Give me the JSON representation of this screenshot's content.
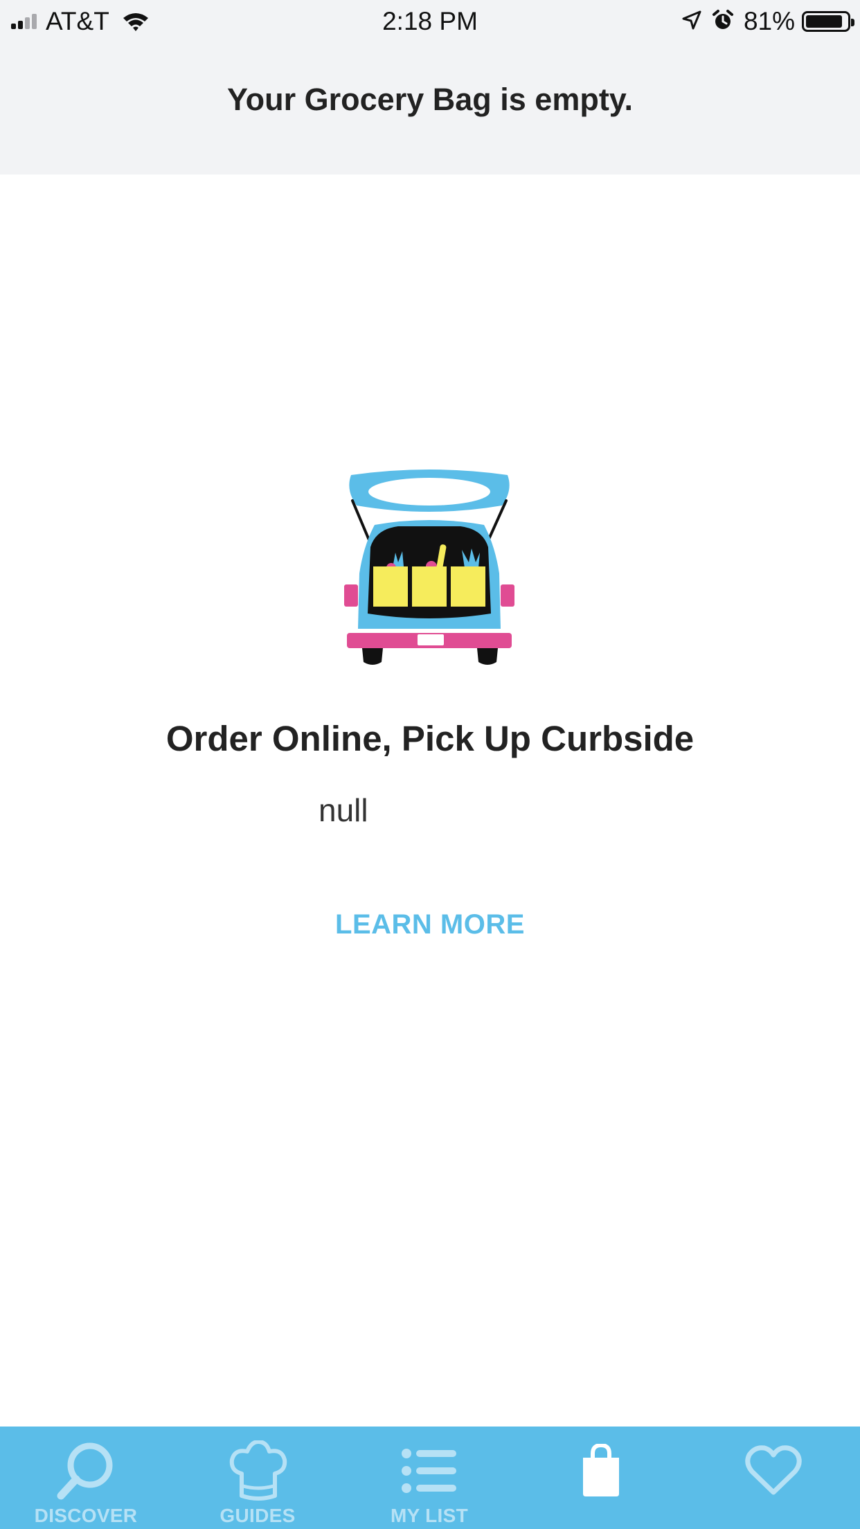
{
  "status_bar": {
    "carrier": "AT&T",
    "time": "2:18 PM",
    "battery_percent": "81%"
  },
  "header": {
    "title": "Your Grocery Bag is empty."
  },
  "promo": {
    "title": "Order Online, Pick Up Curbside",
    "body": "null",
    "link_label": "LEARN MORE"
  },
  "tab_bar": {
    "active_index": 3,
    "tabs": [
      {
        "label": "DISCOVER",
        "icon": "search-icon"
      },
      {
        "label": "GUIDES",
        "icon": "chef-hat-icon"
      },
      {
        "label": "MY LIST",
        "icon": "list-icon"
      },
      {
        "label": "",
        "icon": "shopping-bag-icon"
      },
      {
        "label": "",
        "icon": "heart-icon"
      }
    ]
  },
  "colors": {
    "accent": "#5bbde8",
    "header_bg": "#f2f3f5",
    "tab_inactive": "#b6e1f5",
    "tab_active": "#ffffff",
    "illustration_blue": "#5bbde8",
    "illustration_pink": "#e04c93",
    "illustration_yellow": "#f6ec5c"
  }
}
